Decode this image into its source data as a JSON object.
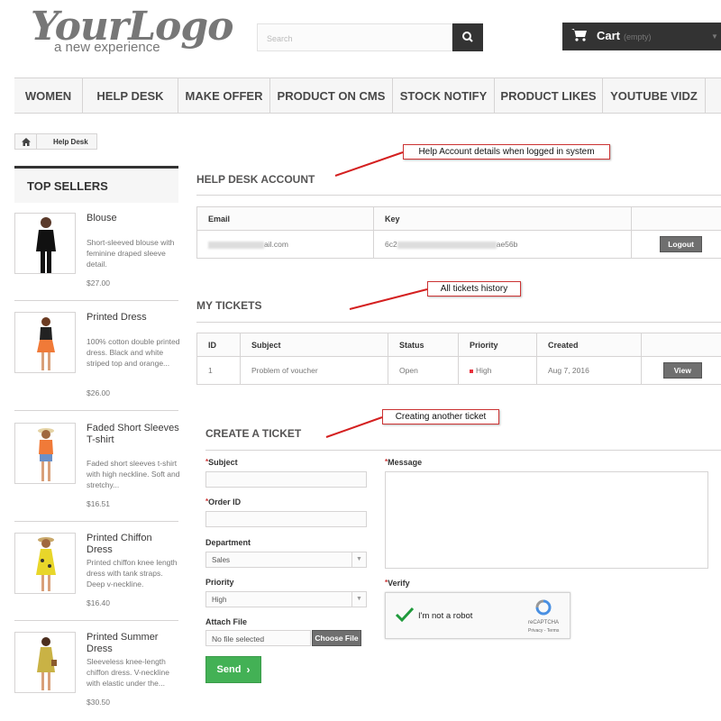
{
  "header": {
    "logo_main": "YourLogo",
    "logo_tag": "a new experience",
    "search_placeholder": "Search",
    "cart_label": "Cart",
    "cart_status": "(empty)"
  },
  "nav": {
    "items": [
      {
        "label": "WOMEN"
      },
      {
        "label": "HELP DESK"
      },
      {
        "label": "MAKE OFFER"
      },
      {
        "label": "PRODUCT ON CMS"
      },
      {
        "label": "STOCK NOTIFY"
      },
      {
        "label": "PRODUCT LIKES"
      },
      {
        "label": "YOUTUBE VIDZ"
      }
    ]
  },
  "breadcrumb": {
    "current": "Help Desk"
  },
  "sidebar": {
    "title": "TOP SELLERS",
    "products": [
      {
        "name": "Blouse",
        "desc": "Short-sleeved blouse with feminine draped sleeve detail.",
        "price": "$27.00"
      },
      {
        "name": "Printed Dress",
        "desc": "100% cotton double printed dress. Black and white striped top and orange...",
        "price": "$26.00"
      },
      {
        "name": "Faded Short Sleeves T-shirt",
        "desc": "Faded short sleeves t-shirt with high neckline. Soft and stretchy...",
        "price": "$16.51"
      },
      {
        "name": "Printed Chiffon Dress",
        "desc": "Printed chiffon knee length dress with tank straps. Deep v-neckline.",
        "price": "$16.40"
      },
      {
        "name": "Printed Summer Dress",
        "desc": "Sleeveless knee-length chiffon dress. V-neckline with elastic under the...",
        "price": "$30.50"
      }
    ]
  },
  "account": {
    "title": "HELP DESK ACCOUNT",
    "col_email": "Email",
    "col_key": "Key",
    "email_visible": "ail.com",
    "key_start": "6c2",
    "key_end": "ae56b",
    "logout_label": "Logout",
    "annotation": "Help Account details when logged in system"
  },
  "tickets": {
    "title": "MY TICKETS",
    "annotation": "All tickets history",
    "columns": [
      "ID",
      "Subject",
      "Status",
      "Priority",
      "Created"
    ],
    "rows": [
      {
        "id": "1",
        "subject": "Problem of voucher",
        "status": "Open",
        "priority": "High",
        "created": "Aug 7, 2016",
        "action": "View"
      }
    ],
    "priority_color": "#e8303c"
  },
  "create": {
    "title": "CREATE A TICKET",
    "annotation": "Creating another ticket",
    "subject_label": "Subject",
    "order_label": "Order ID",
    "department_label": "Department",
    "department_value": "Sales",
    "priority_label": "Priority",
    "priority_value": "High",
    "attach_label": "Attach File",
    "file_status": "No file selected",
    "choose_file": "Choose File",
    "message_label": "Message",
    "verify_label": "Verify",
    "captcha_text": "I'm not a robot",
    "captcha_brand": "reCAPTCHA",
    "captcha_links": "Privacy - Terms",
    "send_label": "Send",
    "required_mark": "*"
  },
  "colors": {
    "send_green": "#43b155",
    "annotation_red": "#d42020",
    "dark": "#333333"
  }
}
